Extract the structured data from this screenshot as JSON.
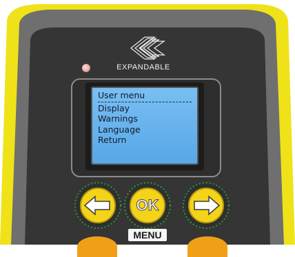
{
  "device": {
    "brand": "EXPANDABLE",
    "colors": {
      "casing": "#f5e61a",
      "faceplate": "#3a3a3a",
      "lcd": "#6db6ef",
      "button": "#f3d41a"
    }
  },
  "screen": {
    "title": "User menu",
    "items": [
      "Display",
      "Warnings",
      "Language",
      "Return"
    ]
  },
  "buttons": {
    "left_icon": "arrow-left-icon",
    "ok_label": "OK",
    "right_icon": "arrow-right-icon",
    "menu_label": "MENU"
  }
}
